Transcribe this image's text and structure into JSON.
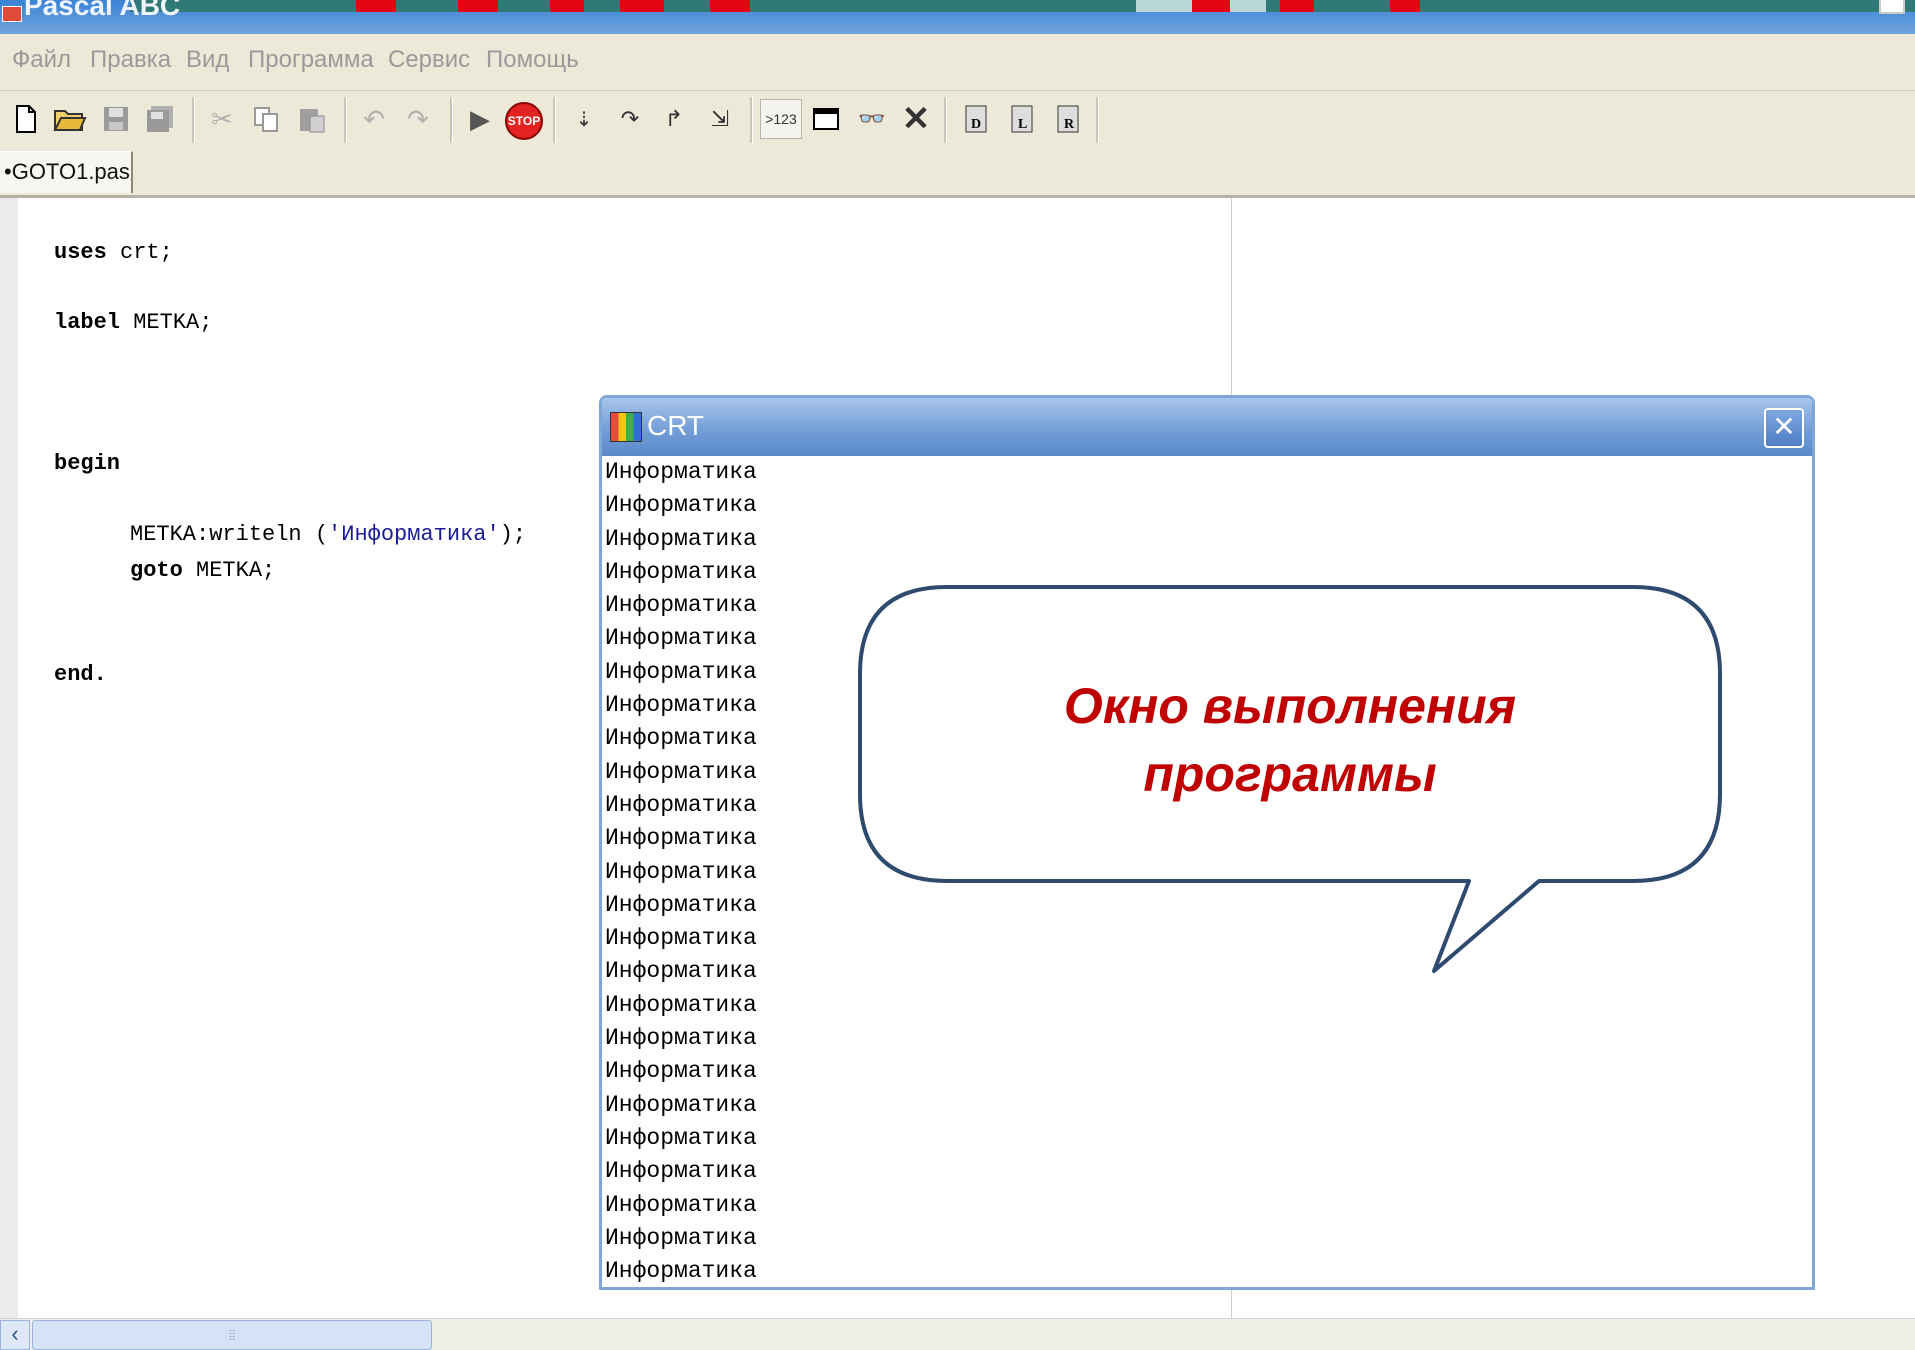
{
  "window": {
    "title": "Pascal ABC"
  },
  "menu": {
    "items": [
      "Файл",
      "Правка",
      "Вид",
      "Программа",
      "Сервис",
      "Помощь"
    ]
  },
  "toolbar": {
    "buttons": [
      "new-file-icon",
      "open-folder-icon",
      "save-icon",
      "save-all-icon",
      "cut-icon",
      "copy-icon",
      "paste-icon",
      "undo-icon",
      "redo-icon",
      "run-icon",
      "stop-icon",
      "step-into-icon",
      "step-over-icon",
      "step-out-icon",
      "run-to-cursor-icon",
      "evaluate-icon",
      "output-window-icon",
      "watch-icon",
      "close-debug-icon",
      "debug-d-icon",
      "debug-l-icon",
      "debug-r-icon"
    ],
    "stop_label": "STOP",
    "evaluate_label": ">123"
  },
  "editor": {
    "tab_label": "•GOTO1.pas",
    "code": {
      "line1_kw": "uses",
      "line1_rest": " crt;",
      "line2_kw": "label",
      "line2_rest": " METKA;",
      "line3_kw": "begin",
      "line4_pre": "METKA:writeln (",
      "line4_str": "'Информатика'",
      "line4_post": ");",
      "line5_kw": "goto",
      "line5_rest": " METKA;",
      "line6_kw": "end."
    }
  },
  "crt_window": {
    "title": "CRT",
    "close_label": "✕",
    "output_line": "Информатика",
    "line_count": 25
  },
  "callout": {
    "line1": "Окно выполнения",
    "line2": "программы"
  },
  "colors": {
    "callout_text": "#c00000",
    "crt_title_bar": "#6f9bd6",
    "string_literal": "#1a1a9c"
  }
}
